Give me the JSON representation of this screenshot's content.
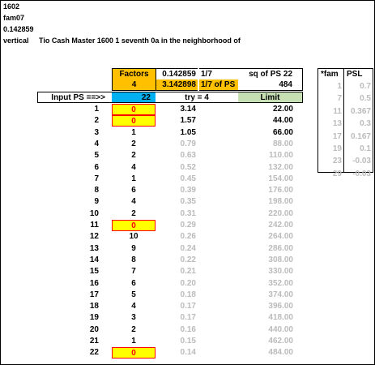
{
  "header": {
    "line1": "1602",
    "line2": "fam07",
    "line3": "0.142859",
    "line4_label": "vertical",
    "line4_text": "Tio Cash Master 1600 1 seventh 0a in the neighborhood of"
  },
  "table": {
    "factors_label": "Factors",
    "factors_value": "4",
    "v1": "0.142859",
    "v1_label": "1/7",
    "v2": "3.142898",
    "v2_label": "1/7 of PS",
    "sq_label": "sq of PS 22",
    "sq_value": "484",
    "input_label": "Input PS ==>>",
    "input_value": "22",
    "try_label": "try = 4",
    "limit_label": "Limit",
    "rows": [
      {
        "n": "1",
        "f": "0",
        "v": "3.14",
        "lim": "22.00"
      },
      {
        "n": "2",
        "f": "0",
        "v": "1.57",
        "lim": "44.00"
      },
      {
        "n": "3",
        "f": "1",
        "v": "1.05",
        "lim": "66.00"
      },
      {
        "n": "4",
        "f": "2",
        "v": "0.79",
        "lim": "88.00"
      },
      {
        "n": "5",
        "f": "2",
        "v": "0.63",
        "lim": "110.00"
      },
      {
        "n": "6",
        "f": "4",
        "v": "0.52",
        "lim": "132.00"
      },
      {
        "n": "7",
        "f": "1",
        "v": "0.45",
        "lim": "154.00"
      },
      {
        "n": "8",
        "f": "6",
        "v": "0.39",
        "lim": "176.00"
      },
      {
        "n": "9",
        "f": "4",
        "v": "0.35",
        "lim": "198.00"
      },
      {
        "n": "10",
        "f": "2",
        "v": "0.31",
        "lim": "220.00"
      },
      {
        "n": "11",
        "f": "0",
        "v": "0.29",
        "lim": "242.00"
      },
      {
        "n": "12",
        "f": "10",
        "v": "0.26",
        "lim": "264.00"
      },
      {
        "n": "13",
        "f": "9",
        "v": "0.24",
        "lim": "286.00"
      },
      {
        "n": "14",
        "f": "8",
        "v": "0.22",
        "lim": "308.00"
      },
      {
        "n": "15",
        "f": "7",
        "v": "0.21",
        "lim": "330.00"
      },
      {
        "n": "16",
        "f": "6",
        "v": "0.20",
        "lim": "352.00"
      },
      {
        "n": "17",
        "f": "5",
        "v": "0.18",
        "lim": "374.00"
      },
      {
        "n": "18",
        "f": "4",
        "v": "0.17",
        "lim": "396.00"
      },
      {
        "n": "19",
        "f": "3",
        "v": "0.17",
        "lim": "418.00"
      },
      {
        "n": "20",
        "f": "2",
        "v": "0.16",
        "lim": "440.00"
      },
      {
        "n": "21",
        "f": "1",
        "v": "0.15",
        "lim": "462.00"
      },
      {
        "n": "22",
        "f": "0",
        "v": "0.14",
        "lim": "484.00"
      }
    ]
  },
  "side_table": {
    "col1": "*fam",
    "col2": "PSL",
    "rows": [
      {
        "a": "1",
        "b": "0.7"
      },
      {
        "a": "7",
        "b": "0.5"
      },
      {
        "a": "11",
        "b": "0.367"
      },
      {
        "a": "13",
        "b": "0.3"
      },
      {
        "a": "17",
        "b": "0.167"
      },
      {
        "a": "19",
        "b": "0.1"
      },
      {
        "a": "23",
        "b": "-0.03"
      },
      {
        "a": "29",
        "b": "-0.03"
      }
    ]
  },
  "colors": {
    "gold": "#ffc000",
    "blue": "#00b0f0",
    "green": "#c6e0b4",
    "red": "#ff0000",
    "yellow": "#ffff00",
    "grey_text": "#bbbbbb"
  }
}
